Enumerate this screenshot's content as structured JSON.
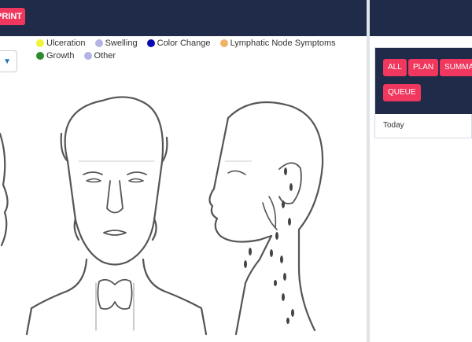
{
  "toolbar": {
    "print_label": "PRINT"
  },
  "legend": [
    {
      "label": "Ulceration",
      "color": "#f1f23a"
    },
    {
      "label": "Swelling",
      "color": "#b3b3e6"
    },
    {
      "label": "Color Change",
      "color": "#0a0ab3"
    },
    {
      "label": "Lymphatic Node Symptoms",
      "color": "#f2b266"
    },
    {
      "label": "Growth",
      "color": "#2d8a2d"
    },
    {
      "label": "Other",
      "color": "#b3b3e6"
    }
  ],
  "panel": {
    "filters": [
      "ALL",
      "PLAN",
      "SUMMARY",
      "QUEUE"
    ],
    "date_label": "Today"
  }
}
